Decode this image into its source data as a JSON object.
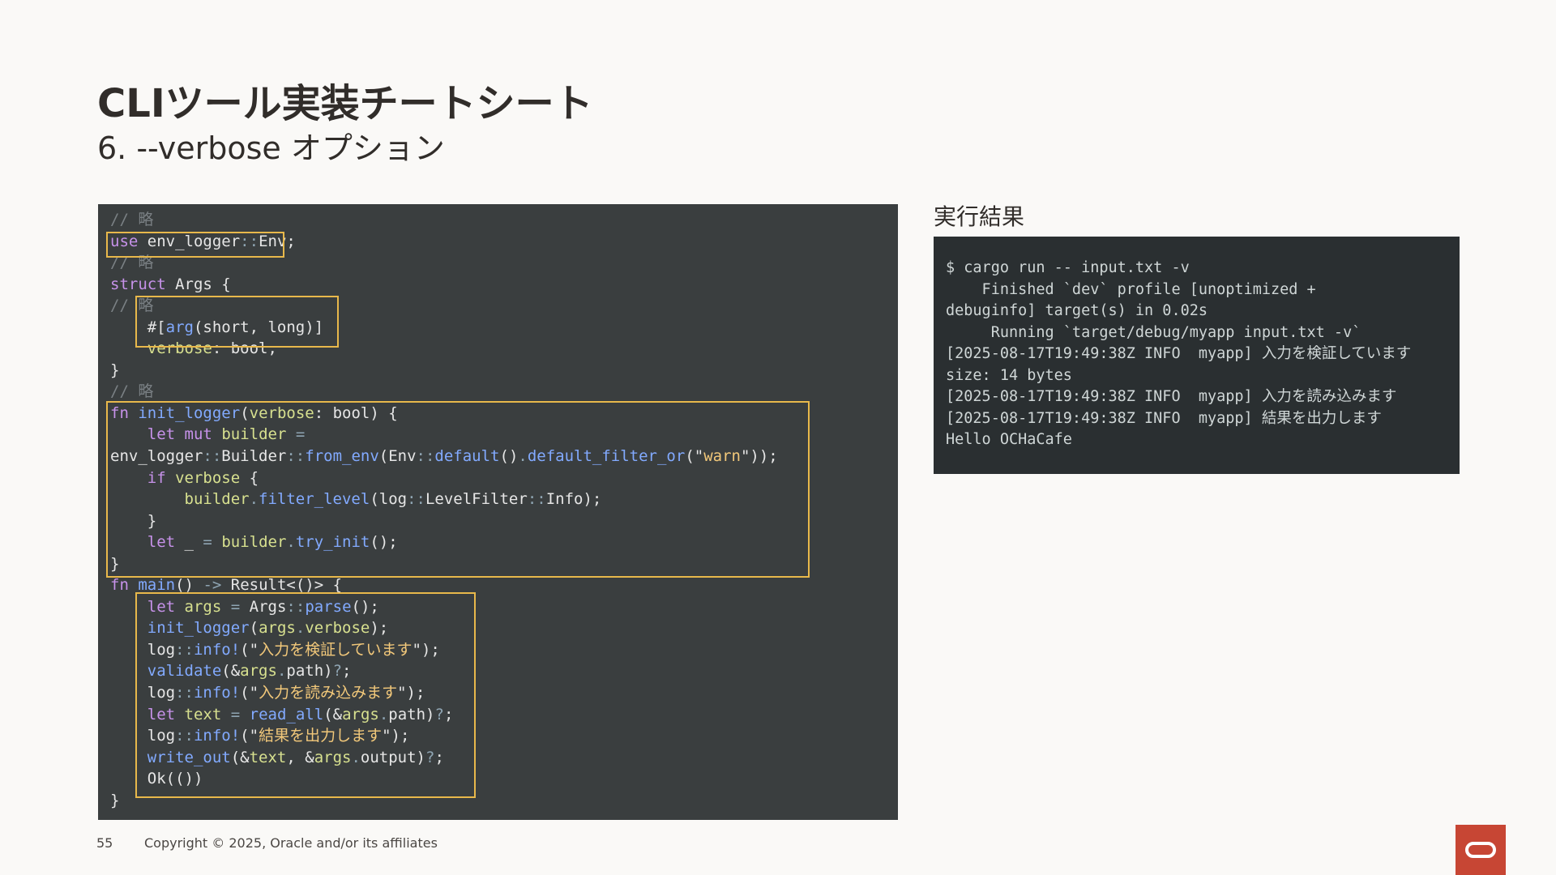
{
  "slide": {
    "title": "CLIツール実装チートシート",
    "subtitle": "6. --verbose オプション",
    "page_number": "55",
    "copyright": "Copyright © 2025, Oracle and/or its affiliates"
  },
  "code": {
    "lines": [
      "// 略",
      "use env_logger::Env;",
      "// 略",
      "struct Args {",
      "// 略",
      "    #[arg(short, long)]",
      "    verbose: bool,",
      "}",
      "// 略",
      "fn init_logger(verbose: bool) {",
      "    let mut builder =",
      "env_logger::Builder::from_env(Env::default().default_filter_or(\"warn\"));",
      "    if verbose {",
      "        builder.filter_level(log::LevelFilter::Info);",
      "    }",
      "    let _ = builder.try_init();",
      "}",
      "fn main() -> Result<()> {",
      "    let args = Args::parse();",
      "    init_logger(args.verbose);",
      "    log::info!(\"入力を検証しています\");",
      "    validate(&args.path)?;",
      "    log::info!(\"入力を読み込みます\");",
      "    let text = read_all(&args.path)?;",
      "    log::info!(\"結果を出力します\");",
      "    write_out(&text, &args.output)?;",
      "    Ok(())",
      "}"
    ]
  },
  "result": {
    "label": "実行結果",
    "lines": [
      "$ cargo run -- input.txt -v",
      "    Finished `dev` profile [unoptimized +",
      "debuginfo] target(s) in 0.02s",
      "     Running `target/debug/myapp input.txt -v`",
      "[2025-08-17T19:49:38Z INFO  myapp] 入力を検証しています",
      "size: 14 bytes",
      "[2025-08-17T19:49:38Z INFO  myapp] 入力を読み込みます",
      "[2025-08-17T19:49:38Z INFO  myapp] 結果を出力します",
      "Hello OCHaCafe"
    ]
  },
  "colors": {
    "highlight_border": "#e8b84b",
    "code_background": "#3a3e3f",
    "terminal_background": "#2a2f31",
    "logo_red": "#c74634"
  },
  "icons": {
    "logo": "oracle-logo-icon"
  }
}
